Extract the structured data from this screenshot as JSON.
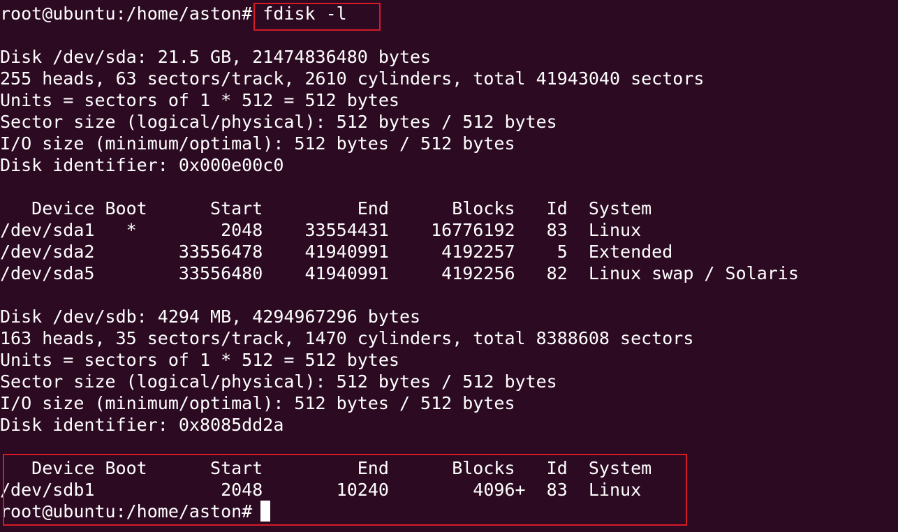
{
  "terminal": {
    "prompt": "root@ubuntu:/home/aston#",
    "command": "fdisk -l",
    "accent_color": "#d51a28",
    "background_color": "#2c0a22",
    "text_color": "#ffffff"
  },
  "lines": [
    "",
    "Disk /dev/sda: 21.5 GB, 21474836480 bytes",
    "255 heads, 63 sectors/track, 2610 cylinders, total 41943040 sectors",
    "Units = sectors of 1 * 512 = 512 bytes",
    "Sector size (logical/physical): 512 bytes / 512 bytes",
    "I/O size (minimum/optimal): 512 bytes / 512 bytes",
    "Disk identifier: 0x000e00c0",
    "",
    "   Device Boot      Start         End      Blocks   Id  System",
    "/dev/sda1   *        2048    33554431    16776192   83  Linux",
    "/dev/sda2        33556478    41940991     4192257    5  Extended",
    "/dev/sda5        33556480    41940991     4192256   82  Linux swap / Solaris",
    "",
    "Disk /dev/sdb: 4294 MB, 4294967296 bytes",
    "163 heads, 35 sectors/track, 1470 cylinders, total 8388608 sectors",
    "Units = sectors of 1 * 512 = 512 bytes",
    "Sector size (logical/physical): 512 bytes / 512 bytes",
    "I/O size (minimum/optimal): 512 bytes / 512 bytes",
    "Disk identifier: 0x8085dd2a",
    "",
    "   Device Boot      Start         End      Blocks   Id  System",
    "/dev/sdb1            2048       10240        4096+  83  Linux"
  ],
  "final_prompt": "root@ubuntu:/home/aston#"
}
